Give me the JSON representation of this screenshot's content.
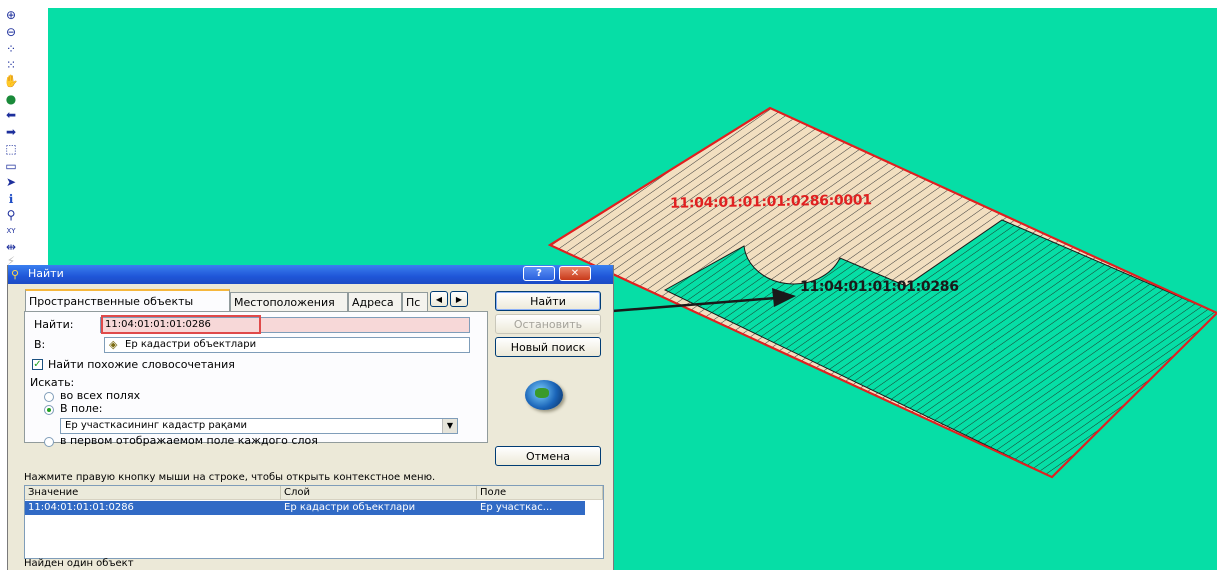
{
  "map": {
    "background": "#06dea6",
    "parcel_outer_label": "11:04:01:01:01:0286:0001",
    "parcel_inner_label": "11:04:01:01:01:0286",
    "outer_fill": "#f2dfc0",
    "inner_fill": "#06dea6",
    "outline": "#e02020",
    "outer_label_color": "#e02020",
    "inner_label_color": "#1a1a1a"
  },
  "toolbar": {
    "tools": [
      {
        "name": "zoom-in-icon",
        "glyph": "⊕"
      },
      {
        "name": "zoom-out-icon",
        "glyph": "⊖"
      },
      {
        "name": "fixed-zoom-in-icon",
        "glyph": "⁘"
      },
      {
        "name": "fixed-zoom-out-icon",
        "glyph": "⁙"
      },
      {
        "name": "pan-hand-icon",
        "glyph": "✋"
      },
      {
        "name": "full-extent-globe-icon",
        "glyph": "●"
      },
      {
        "name": "back-arrow-icon",
        "glyph": "⬅"
      },
      {
        "name": "forward-arrow-icon",
        "glyph": "➡"
      },
      {
        "name": "select-features-icon",
        "glyph": "⬚"
      },
      {
        "name": "clear-selection-icon",
        "glyph": "▭"
      },
      {
        "name": "select-pointer-icon",
        "glyph": "➤"
      },
      {
        "name": "identify-icon",
        "glyph": "ℹ"
      },
      {
        "name": "find-binoculars-icon",
        "glyph": "⚲"
      },
      {
        "name": "goto-xy-icon",
        "glyph": "XY"
      },
      {
        "name": "measure-icon",
        "glyph": "⇹"
      },
      {
        "name": "hyperlink-icon",
        "glyph": "⚡"
      }
    ]
  },
  "dialog": {
    "title": "Найти",
    "tabs": [
      "Пространственные объекты",
      "Местоположения",
      "Адреса",
      "Пс"
    ],
    "find_label": "Найти:",
    "find_value": "11:04:01:01:01:0286",
    "in_label": "В:",
    "in_value": "Ер кадастри объектлари",
    "similar_label": "Найти похожие словосочетания",
    "search_label": "Искать:",
    "radio_all_fields": "во всех полях",
    "radio_in_field": "В поле:",
    "field_value": "Ер участкасининг кадастр рақами",
    "radio_first_field": "в первом отображаемом поле каждого слоя",
    "btn_find": "Найти",
    "btn_stop": "Остановить",
    "btn_new": "Новый поиск",
    "btn_cancel": "Отмена",
    "hint": "Нажмите правую кнопку мыши на строке, чтобы открыть контекстное меню.",
    "columns": [
      "Значение",
      "Слой",
      "Поле"
    ],
    "rows": [
      {
        "value": "11:04:01:01:01:0286",
        "layer": "Ер кадастри объектлари",
        "field": "Ер участкас..."
      }
    ],
    "status": "Найден один объект",
    "help_btn": "?",
    "close_btn": "✕"
  }
}
